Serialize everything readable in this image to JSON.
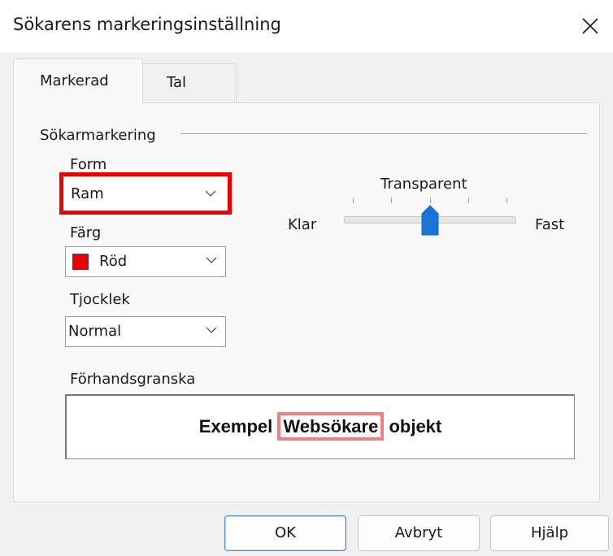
{
  "window": {
    "title": "Sökarens markeringsinställning",
    "close_icon": "close-icon"
  },
  "tabs": [
    {
      "label": "Markerad",
      "active": true
    },
    {
      "label": "Tal",
      "active": false
    }
  ],
  "group": {
    "label": "Sökarmarkering"
  },
  "form": {
    "label": "Form",
    "value": "Ram"
  },
  "color": {
    "label": "Färg",
    "value": "Röd",
    "swatch": "#ee0000"
  },
  "thickness": {
    "label": "Tjocklek",
    "value": "Normal"
  },
  "transparency": {
    "title": "Transparent",
    "min_label": "Klar",
    "max_label": "Fast",
    "level": 0.5
  },
  "preview": {
    "label": "Förhandsgranska",
    "before": "Exempel ",
    "highlighted": "Websökare",
    "after": " objekt",
    "highlight_color": "#f08080"
  },
  "buttons": {
    "ok": "OK",
    "cancel": "Avbryt",
    "help": "Hjälp"
  }
}
